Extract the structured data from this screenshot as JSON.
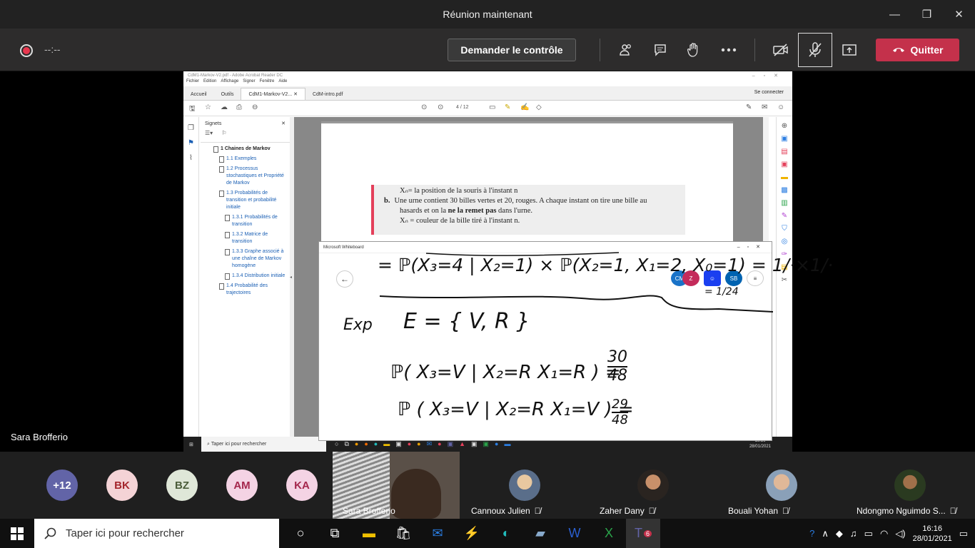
{
  "window": {
    "title": "Réunion maintenant",
    "minimize": "—",
    "maximize": "❐",
    "close": "✕"
  },
  "toolbar": {
    "timer": "--:--",
    "request_control": "Demander le contrôle",
    "leave": "Quitter",
    "icons": {
      "participants": "participants-icon",
      "chat": "chat-icon",
      "raise_hand": "hand-icon",
      "more": "more-icon",
      "camera": "camera-off-icon",
      "mic": "mic-off-icon",
      "share": "share-icon"
    }
  },
  "acrobat": {
    "title": "CdM1-Markov-V2.pdf - Adobe Acrobat Reader DC",
    "menu": [
      "Fichier",
      "Edition",
      "Affichage",
      "Signer",
      "Fenêtre",
      "Aide"
    ],
    "tabs": [
      "Accueil",
      "Outils",
      "CdM1-Markov-V2...",
      "CdM-intro.pdf"
    ],
    "signin": "Se connecter",
    "page_indicator": "4 / 12",
    "bookmarks_title": "Signets",
    "bookmarks": [
      {
        "level": 1,
        "label": "1 Chaines de Markov"
      },
      {
        "level": 2,
        "label": "1.1 Exemples"
      },
      {
        "level": 2,
        "label": "1.2 Processus stochastiques et Propriété de Markov"
      },
      {
        "level": 2,
        "label": "1.3 Probabilités de transition et probabilité initiale"
      },
      {
        "level": 3,
        "label": "1.3.1 Probabilités de transition"
      },
      {
        "level": 3,
        "label": "1.3.2 Matrice de transition"
      },
      {
        "level": 3,
        "label": "1.3.3 Graphe associé à une chaîne de Markov homogène"
      },
      {
        "level": 3,
        "label": "1.3.4 Distribution initiale"
      },
      {
        "level": 2,
        "label": "1.4 Probabilité des trajectoires"
      }
    ],
    "exercise": {
      "line1": "Xₙ= la position de la souris à l'instant n",
      "b_label": "b.",
      "line2": "Une urne contient 30 billes vertes et 20, rouges. A chaque instant on tire une bille au",
      "line3a": "hasards et on la ",
      "line3b": "ne la remet pas",
      "line3c": " dans l'urne.",
      "line4": "Xₙ = couleur de la bille tiré à l'instant n."
    }
  },
  "inner_taskbar": {
    "search": "Taper ici pour rechercher",
    "time": "16:16",
    "date": "28/01/2021"
  },
  "whiteboard": {
    "title": "Microsoft Whiteboard",
    "back": "←",
    "avatars": [
      "CM",
      "Z",
      "SB"
    ],
    "menu_icon": "≡",
    "ink": {
      "line1": "= ℙ(X₃=4 | X₂=1) × ℙ(X₂=1, X₁=2, X₀=1) = 1/·×1/·",
      "line1b": "= 1/24",
      "exp": "Exp",
      "set": "E = { V, R }",
      "p1": "ℙ( X₃=V | X₂=R   X₁=R ) =",
      "p1_num": "30",
      "p1_den": "48",
      "p2": "ℙ ( X₃=V | X₂=R   X₁=V ) =",
      "p2_num": "29",
      "p2_den": "48"
    }
  },
  "presenter": "Sara Brofferio",
  "participants": {
    "overflow": "+12",
    "initials": [
      "BK",
      "BZ",
      "AM",
      "KA"
    ],
    "video": {
      "name": "Sara Brofferio"
    },
    "tiles": [
      {
        "name": "Cannoux Julien"
      },
      {
        "name": "Zaher Dany"
      },
      {
        "name": "Bouali Yohan"
      },
      {
        "name": "Ndongmo Nguimdo S..."
      }
    ]
  },
  "taskbar": {
    "search": "Taper ici pour rechercher",
    "time": "16:16",
    "date": "28/01/2021",
    "teams_badge": "6"
  },
  "colors": {
    "leave": "#c4314b",
    "accent_red": "#e43f5a",
    "overflow": "#6264a7"
  }
}
